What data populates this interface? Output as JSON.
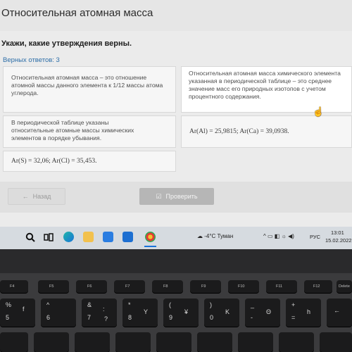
{
  "page": {
    "title": "Относительная атомная масса",
    "question": "Укажи, какие утверждения верны.",
    "correct_count": "Верных ответов: 3"
  },
  "cards": {
    "c1": "Относительная атомная масса – это отношение атомной массы данного элемента к 1/12 массы атома углерода.",
    "c2": "Относительная атомная масса химического элемента указанная в периодической таблице – это среднее значение масс его природных изотопов с учетом процентного содержания.",
    "c3": "В периодической таблице указаны относительные атомные массы химических элементов в порядке убывания.",
    "c4": "Ar(Al) = 25,9815; Ar(Ca) = 39,0938.",
    "c5": "Ar(S) = 32,06; Ar(Cl) = 35,453."
  },
  "buttons": {
    "back": "Назад",
    "check": "Проверить"
  },
  "taskbar": {
    "weather": "-4°C Туман",
    "lang": "РУС",
    "time": "13:01",
    "date": "15.02.2022"
  },
  "keyboard": {
    "fkeys": [
      "F4",
      "F5",
      "F6",
      "F7",
      "F8",
      "F9",
      "F10",
      "F11",
      "F12",
      "Delete"
    ],
    "num_row": [
      {
        "top": "%",
        "bottom": "5"
      },
      {
        "top": "^",
        "bottom": "6"
      },
      {
        "top": "&",
        "bottom": "7"
      },
      {
        "top": "*",
        "bottom": "8"
      },
      {
        "top": "(",
        "bottom": "9"
      },
      {
        "top": ")",
        "bottom": "0"
      },
      {
        "top": "_",
        "bottom": "-"
      },
      {
        "top": "+",
        "bottom": "="
      }
    ],
    "letters": [
      "f",
      ":",
      "?",
      "Y",
      "¥",
      "K",
      "Θ",
      "h"
    ]
  },
  "colors": {
    "accent": "#2d6ea8",
    "card_border": "#d8d8d8",
    "check_button": "#b6b6b6",
    "taskbar": "#d6dbe0"
  }
}
